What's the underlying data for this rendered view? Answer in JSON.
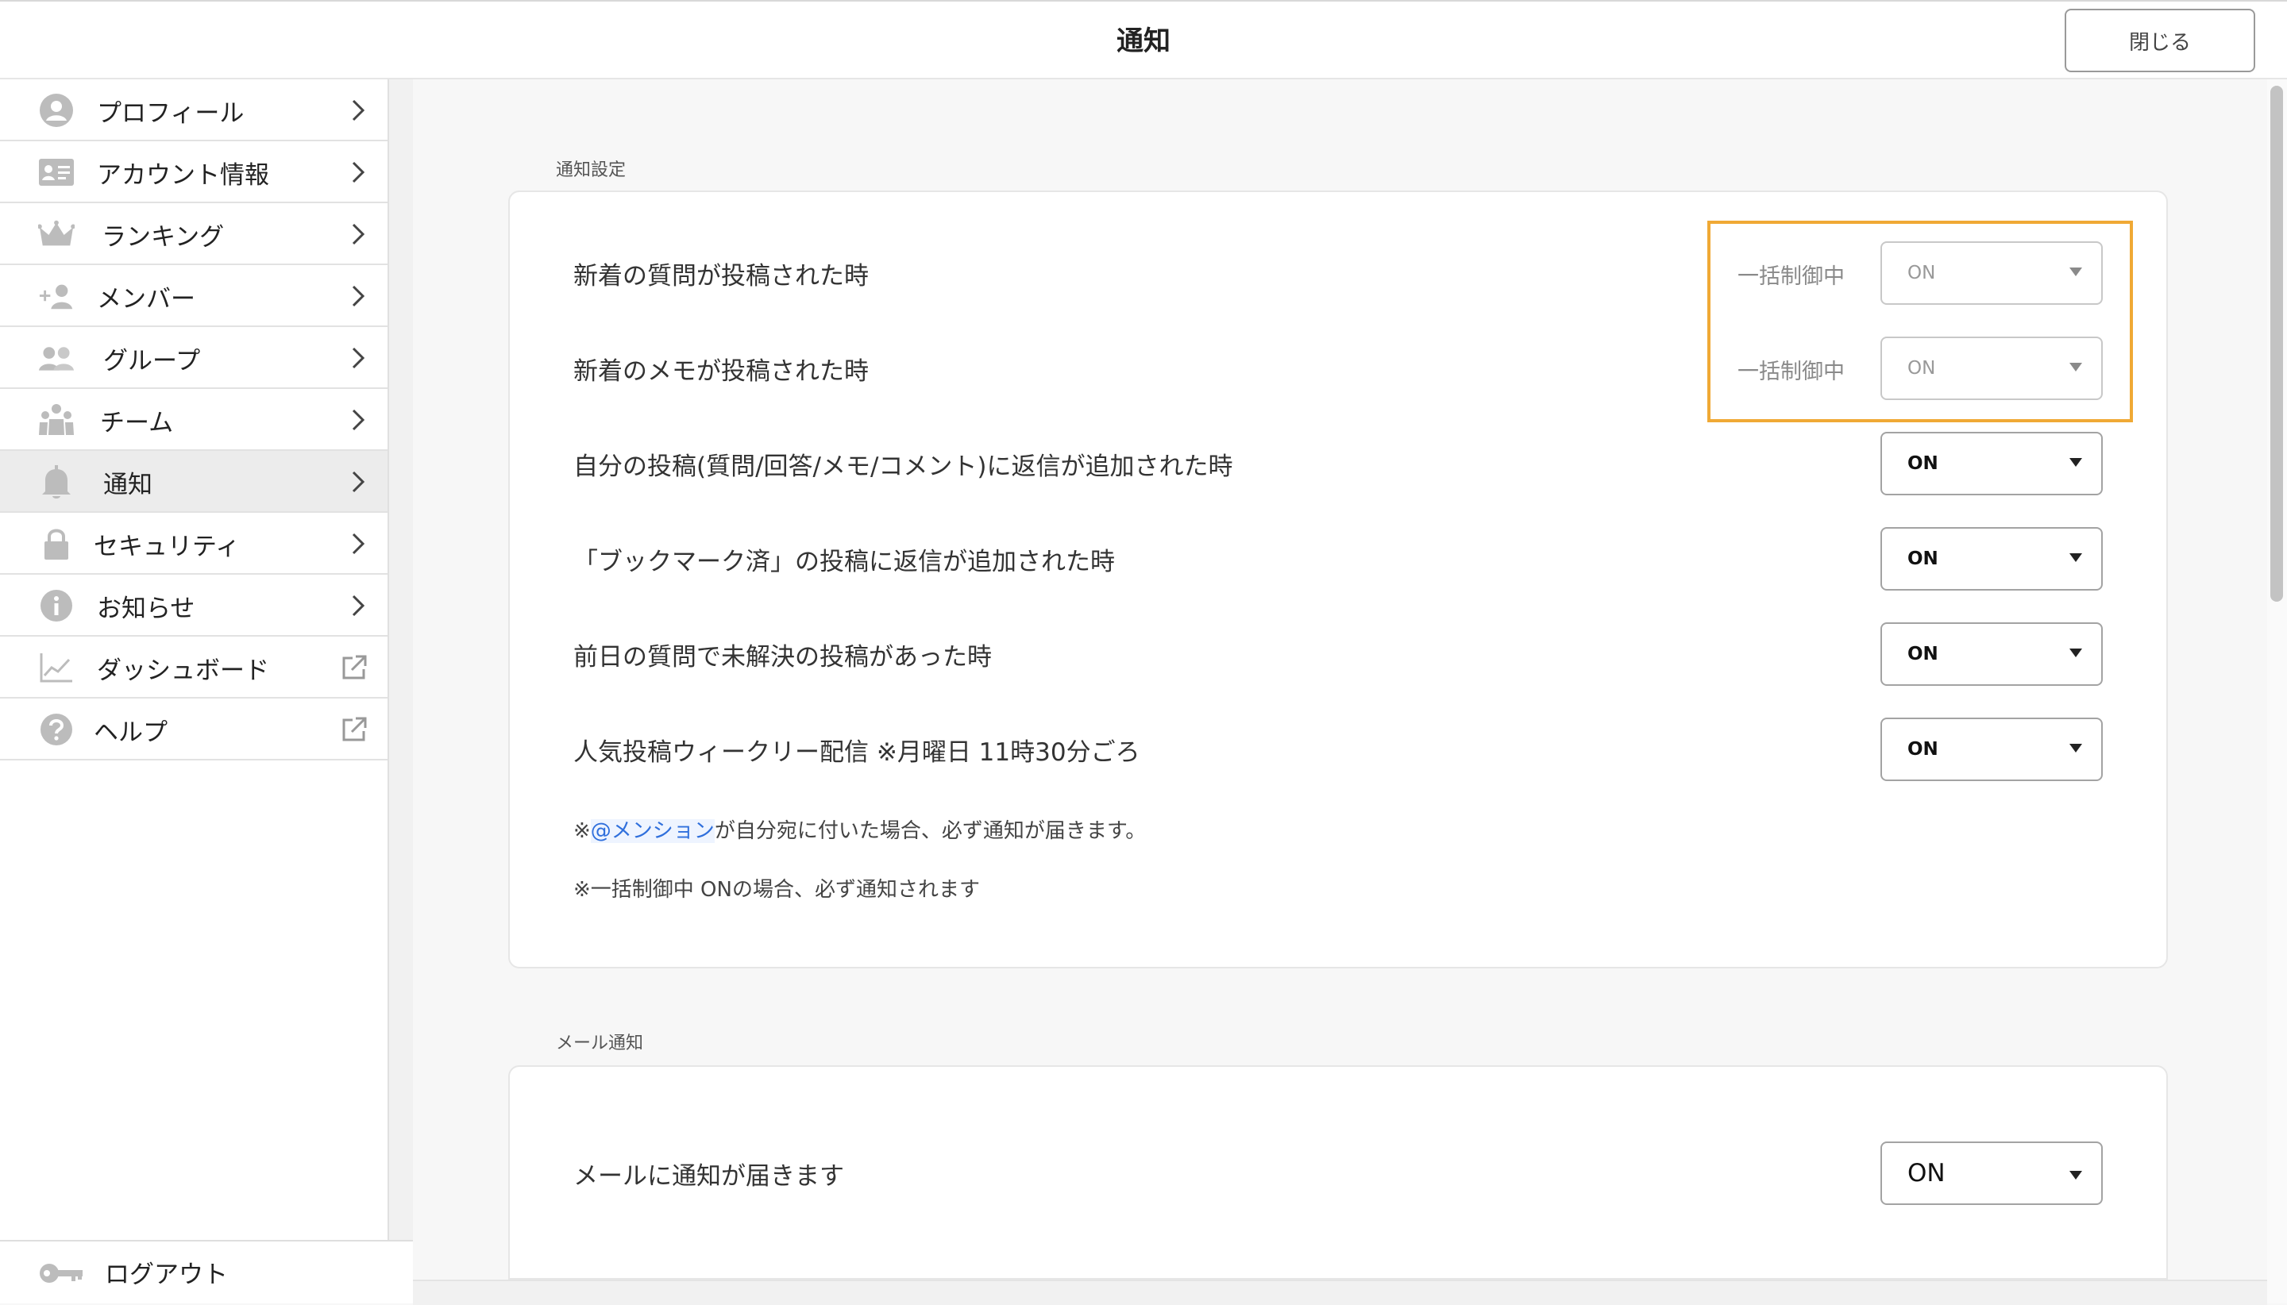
{
  "header": {
    "title": "通知",
    "close_label": "閉じる"
  },
  "sidebar": {
    "items": [
      {
        "label": "プロフィール",
        "icon": "user-circle-icon",
        "arrow": "chevron-right-icon"
      },
      {
        "label": "アカウント情報",
        "icon": "id-card-icon",
        "arrow": "chevron-right-icon"
      },
      {
        "label": "ランキング",
        "icon": "crown-icon",
        "arrow": "chevron-right-icon"
      },
      {
        "label": "メンバー",
        "icon": "add-person-icon",
        "arrow": "chevron-right-icon"
      },
      {
        "label": "グループ",
        "icon": "group-icon",
        "arrow": "chevron-right-icon"
      },
      {
        "label": "チーム",
        "icon": "team-icon",
        "arrow": "chevron-right-icon"
      },
      {
        "label": "通知",
        "icon": "bell-icon",
        "arrow": "chevron-right-icon",
        "active": true
      },
      {
        "label": "セキュリティ",
        "icon": "lock-icon",
        "arrow": "chevron-right-icon"
      },
      {
        "label": "お知らせ",
        "icon": "info-icon",
        "arrow": "chevron-right-icon"
      },
      {
        "label": "ダッシュボード",
        "icon": "chart-icon",
        "arrow": "external-link-icon"
      },
      {
        "label": "ヘルプ",
        "icon": "help-icon",
        "arrow": "external-link-icon"
      }
    ],
    "logout_label": "ログアウト",
    "logout_icon": "key-icon"
  },
  "notification_settings": {
    "section_title": "通知設定",
    "rows": [
      {
        "label": "新着の質問が投稿された時",
        "batch_label": "一括制御中",
        "value": "ON",
        "disabled": true
      },
      {
        "label": "新着のメモが投稿された時",
        "batch_label": "一括制御中",
        "value": "ON",
        "disabled": true
      },
      {
        "label": "自分の投稿(質問/回答/メモ/コメント)に返信が追加された時",
        "value": "ON"
      },
      {
        "label": "「ブックマーク済」の投稿に返信が追加された時",
        "value": "ON"
      },
      {
        "label": "前日の質問で未解決の投稿があった時",
        "value": "ON"
      },
      {
        "label": "人気投稿ウィークリー配信 ※月曜日 11時30分ごろ",
        "value": "ON"
      }
    ],
    "note1_prefix": "※",
    "note1_mention": "@メンション",
    "note1_suffix": "が自分宛に付いた場合、必ず通知が届きます。",
    "note2": "※一括制御中 ONの場合、必ず通知されます"
  },
  "mail_notification": {
    "section_title": "メール通知",
    "label": "メールに通知が届きます",
    "value": "ON"
  },
  "colors": {
    "highlight": "#f0a935",
    "mention": "#2f6fdc",
    "icon_gray": "#b5b5b5"
  }
}
